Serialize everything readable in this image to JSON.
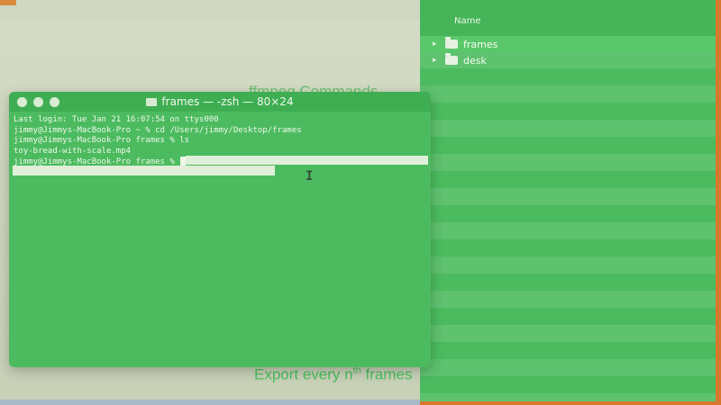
{
  "background_app": {
    "heading_partial": "ffmpeg Commands",
    "export_text": "Export every n",
    "export_sup": "th",
    "export_tail": " frames"
  },
  "finder": {
    "column_name": "Name",
    "items": [
      {
        "name": "frames",
        "selected": true
      },
      {
        "name": "desk",
        "selected": false
      }
    ]
  },
  "terminal": {
    "title": "frames — -zsh — 80×24",
    "lines": [
      "Last login: Tue Jan 21 16:07:54 on ttys000",
      "jimmy@Jimmys-MacBook-Pro ~ % cd /Users/jimmy/Desktop/frames",
      "jimmy@Jimmys-MacBook-Pro frames % ls",
      "toy-bread-with-scale.mp4",
      "jimmy@Jimmys-MacBook-Pro frames % "
    ]
  },
  "colors": {
    "terminal_bg": "#4cbb5f",
    "finder_border": "#d8772e",
    "accent_text": "#4cbf5e"
  },
  "icons": {
    "traffic_lights": "window-controls-icon",
    "folder": "folder-icon",
    "disclosure": "chevron-right-icon",
    "text_cursor": "ibeam-cursor-icon"
  }
}
